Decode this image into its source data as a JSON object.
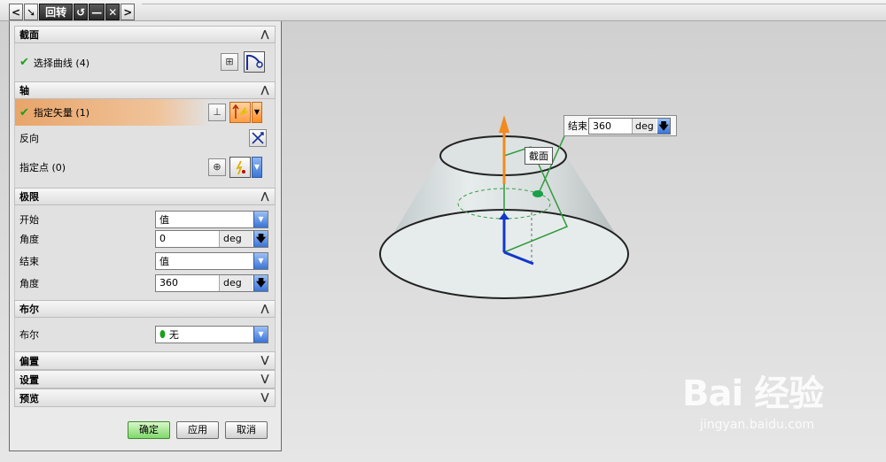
{
  "titlebar": {
    "left_arrow": "<",
    "pin": "➘",
    "title": "回转",
    "refresh": "↺",
    "minimize": "—",
    "close": "✕",
    "right_arrow": ">"
  },
  "sections": {
    "section": {
      "title": "截面",
      "select_curve_label": "选择曲线 (4)"
    },
    "axis": {
      "title": "轴",
      "specify_vector_label": "指定矢量 (1)",
      "reverse_label": "反向",
      "specify_point_label": "指定点 (0)"
    },
    "limits": {
      "title": "极限",
      "start_label": "开始",
      "start_value": "值",
      "start_angle_label": "角度",
      "start_angle_value": "0",
      "start_angle_unit": "deg",
      "end_label": "结束",
      "end_value": "值",
      "end_angle_label": "角度",
      "end_angle_value": "360",
      "end_angle_unit": "deg"
    },
    "boolean": {
      "title": "布尔",
      "label": "布尔",
      "value": "无"
    },
    "offset": {
      "title": "偏置"
    },
    "settings": {
      "title": "设置"
    },
    "preview": {
      "title": "预览"
    }
  },
  "footer": {
    "ok": "确定",
    "apply": "应用",
    "cancel": "取消"
  },
  "viewport": {
    "callout_label": "结束",
    "callout_value": "360",
    "callout_unit": "deg",
    "section_tag": "截面"
  },
  "watermark": {
    "brand": "Bai  经验",
    "url": "jingyan.baidu.com"
  },
  "colors": {
    "check": "#1aa11a",
    "highlight": "#e8a56a",
    "accent_blue": "#3a74d6",
    "ok_green": "#7fd86a"
  }
}
